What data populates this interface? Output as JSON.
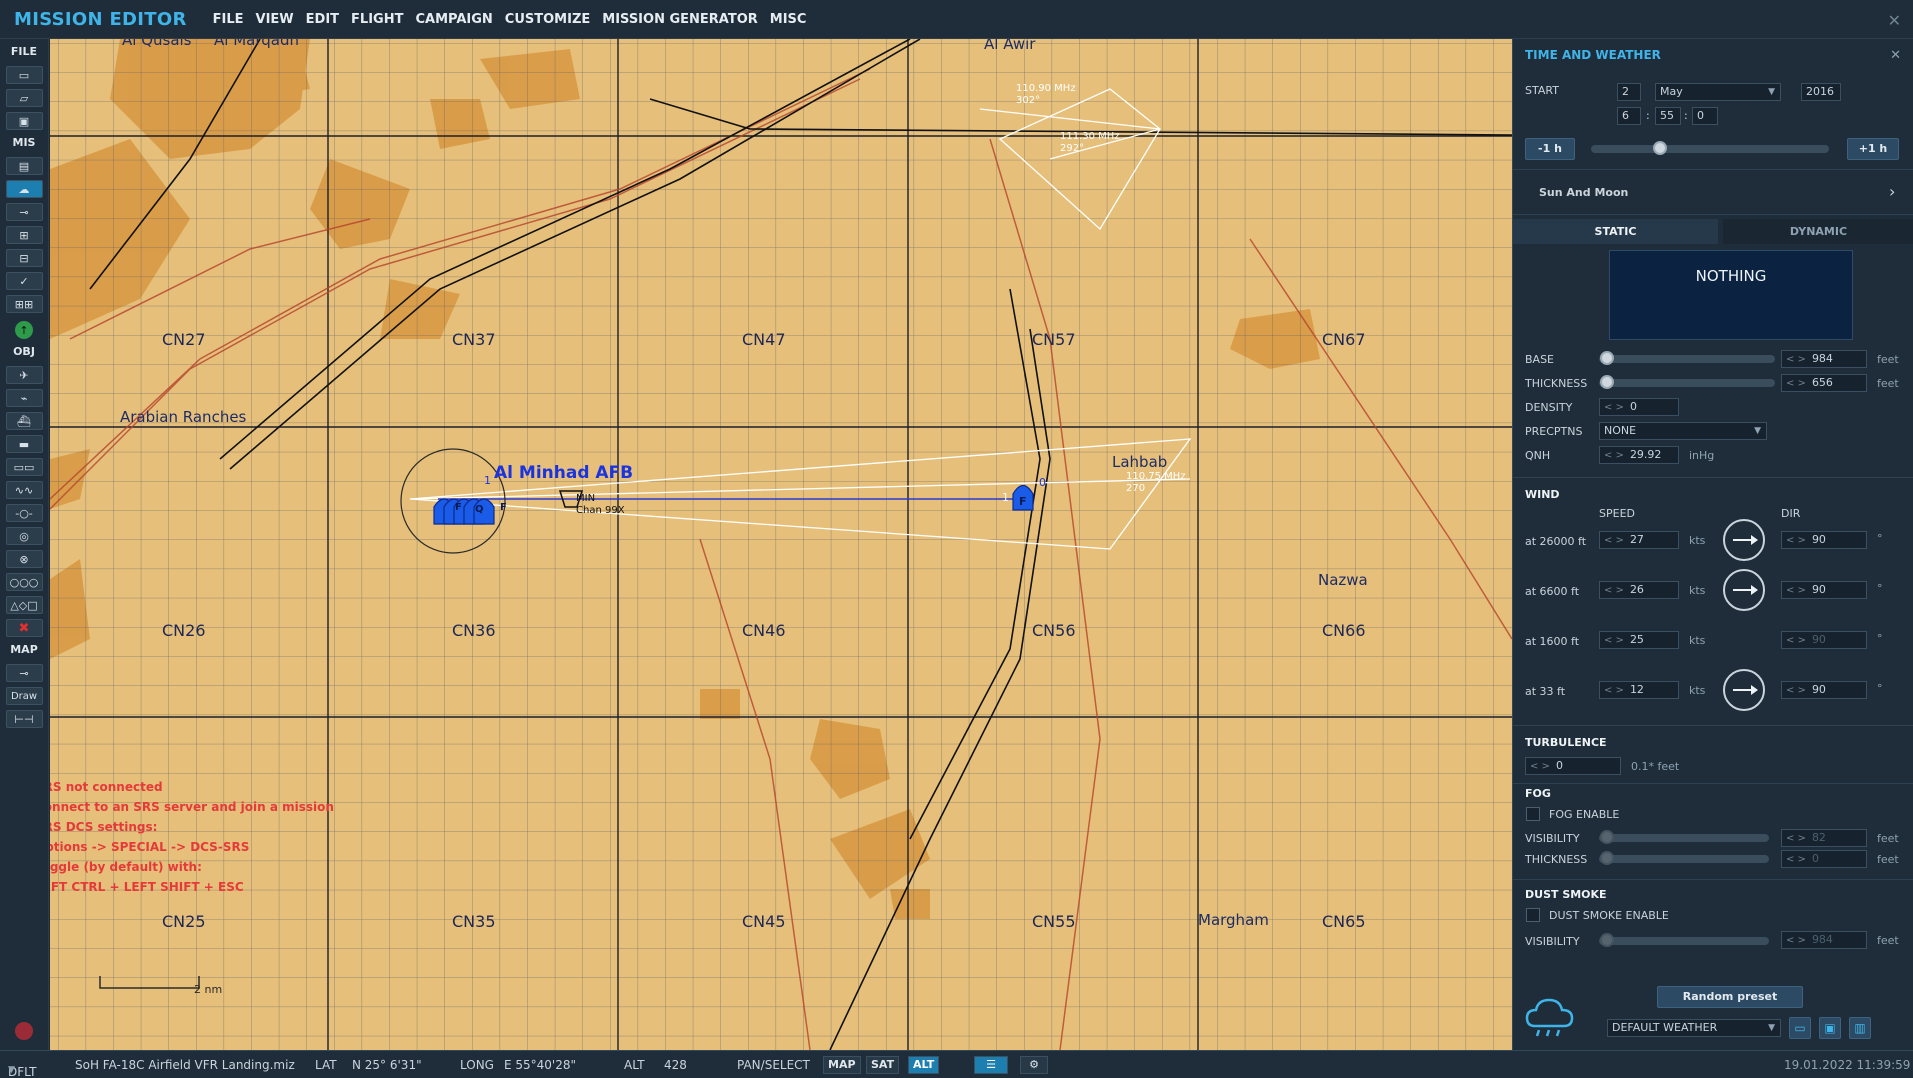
{
  "app": {
    "title": "MISSION EDITOR"
  },
  "menu": [
    "FILE",
    "VIEW",
    "EDIT",
    "FLIGHT",
    "CAMPAIGN",
    "CUSTOMIZE",
    "MISSION GENERATOR",
    "MISC"
  ],
  "toolbar": {
    "file_label": "FILE",
    "mis_label": "MIS",
    "obj_label": "OBJ",
    "map_label": "MAP",
    "draw_label": "Draw",
    "icons": [
      "file-new-icon",
      "file-open-icon",
      "file-save-icon",
      "briefing-icon",
      "weather-icon",
      "trigger-icon",
      "triggered-actions-icon",
      "failures-icon",
      "check-icon",
      "options-icon",
      "airplane-icon",
      "helicopter-icon",
      "ship-icon",
      "vehicle-icon",
      "static-object-icon",
      "template-icon",
      "route-icon",
      "target-icon",
      "airbase-icon",
      "zone-icon",
      "shapes-icon",
      "delete-icon",
      "map-options-icon",
      "draw-icon",
      "ruler-icon"
    ]
  },
  "map": {
    "grid_labels": [
      "CN27",
      "CN37",
      "CN47",
      "CN57",
      "CN67",
      "CN26",
      "CN36",
      "CN46",
      "CN56",
      "CN66",
      "CN25",
      "CN35",
      "CN45",
      "CN55",
      "CN65"
    ],
    "places": [
      "Al Qusais",
      "Al Marqadh",
      "Al Awir",
      "Arabian Ranches",
      "Lahbab",
      "Nazwa",
      "Margham"
    ],
    "airbase": "Al Minhad AFB",
    "navaid": [
      "MIN",
      "Chan 99X"
    ],
    "freqs": [
      "110.90 MHz",
      "302°",
      "111.30 MHz",
      "292°",
      "110.75 MHz",
      "270"
    ],
    "group_num_a": "1",
    "group_num_b": "0",
    "group_num_c": "1",
    "group_letters": [
      "F",
      "Q",
      "F"
    ],
    "group_f": "F",
    "scale": "2 nm",
    "srs_messages": [
      "SRS not connected",
      "Connect to an SRS server and join a mission",
      "SRS DCS settings:",
      "Options -> SPECIAL -> DCS-SRS",
      "Toggle (by default) with:",
      "LEFT CTRL + LEFT SHIFT + ESC"
    ]
  },
  "panel": {
    "title": "TIME AND WEATHER",
    "start_label": "START",
    "day": "2",
    "month": "May",
    "year": "2016",
    "hour": "6",
    "minute": "55",
    "second": "0",
    "minus_hour": "-1 h",
    "plus_hour": "+1 h",
    "sun_moon": "Sun And Moon",
    "tab_static": "STATIC",
    "tab_dynamic": "DYNAMIC",
    "cloud_preset": "NOTHING",
    "base_label": "BASE",
    "base_value": "984",
    "thickness_label": "THICKNESS",
    "thickness_value": "656",
    "density_label": "DENSITY",
    "density_value": "0",
    "precip_label": "PRECPTNS",
    "precip_value": "NONE",
    "qnh_label": "QNH",
    "qnh_value": "29.92",
    "unit_feet": "feet",
    "unit_inhg": "inHg",
    "unit_kts": "kts",
    "unit_deg": "°",
    "wind_label": "WIND",
    "speed_label": "SPEED",
    "dir_label": "DIR",
    "wind": [
      {
        "alt": "at 26000 ft",
        "speed": "27",
        "dir": "90"
      },
      {
        "alt": "at 6600 ft",
        "speed": "26",
        "dir": "90"
      },
      {
        "alt": "at 1600 ft",
        "speed": "25",
        "dir": "90"
      },
      {
        "alt": "at 33 ft",
        "speed": "12",
        "dir": "90"
      }
    ],
    "turbulence_label": "TURBULENCE",
    "turbulence_value": "0",
    "turbulence_unit": "0.1* feet",
    "fog_label": "FOG",
    "fog_enable": "FOG ENABLE",
    "visibility_label": "VISIBILITY",
    "fog_visibility": "82",
    "fog_thickness": "0",
    "dust_label": "DUST SMOKE",
    "dust_enable": "DUST SMOKE ENABLE",
    "dust_visibility": "984",
    "random_preset": "Random preset",
    "weather_preset": "DEFAULT WEATHER"
  },
  "status": {
    "layer": "DFLT",
    "mission_file": "SoH FA-18C Airfield VFR Landing.miz",
    "lat_label": "LAT",
    "lat": "N 25° 6'31\"",
    "long_label": "LONG",
    "long": "E 55°40'28\"",
    "alt_label": "ALT",
    "alt": "428",
    "mode": "PAN/SELECT",
    "map_btn": "MAP",
    "sat_btn": "SAT",
    "alt_btn": "ALT",
    "datetime": "19.01.2022 11:39:59"
  },
  "colors": {
    "accent": "#3fb4e8",
    "panel_bg": "#1f2d3a",
    "map_bg": "#e6c07a",
    "srs_text": "#e53a3a",
    "airbase": "#1a34e0"
  }
}
